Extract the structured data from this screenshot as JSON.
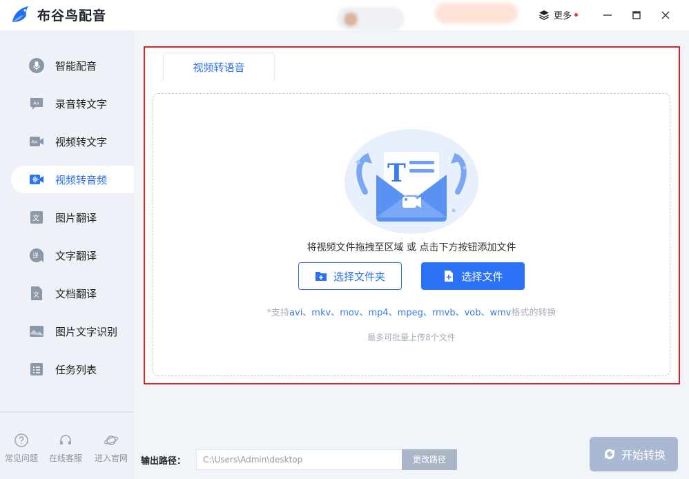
{
  "app": {
    "name": "布谷鸟配音",
    "more_label": "更多"
  },
  "sidebar": {
    "items": [
      {
        "label": "智能配音",
        "icon": "mic-icon"
      },
      {
        "label": "录音转文字",
        "icon": "audio-to-text-icon"
      },
      {
        "label": "视频转文字",
        "icon": "video-to-text-icon"
      },
      {
        "label": "视频转音频",
        "icon": "video-to-audio-icon",
        "active": true
      },
      {
        "label": "图片翻译",
        "icon": "image-translate-icon"
      },
      {
        "label": "文字翻译",
        "icon": "text-translate-icon"
      },
      {
        "label": "文档翻译",
        "icon": "document-translate-icon"
      },
      {
        "label": "图片文字识别",
        "icon": "image-ocr-icon"
      },
      {
        "label": "任务列表",
        "icon": "task-list-icon"
      }
    ],
    "footer": [
      {
        "label": "常见问题",
        "icon": "question-icon"
      },
      {
        "label": "在线客服",
        "icon": "headset-icon"
      },
      {
        "label": "进入官网",
        "icon": "planet-icon"
      }
    ]
  },
  "main": {
    "tab_label": "视频转语音",
    "drop_hint": "将视频文件拖拽至区域 或 点击下方按钮添加文件",
    "select_folder_label": "选择文件夹",
    "select_file_label": "选择文件",
    "formats_prefix": "*支持",
    "formats_list": "avi、mkv、mov、mp4、mpeg、rmvb、vob、wmv",
    "formats_suffix": "格式的转换",
    "limit_text": "最多可批量上传8个文件"
  },
  "footer": {
    "output_label": "输出路径：",
    "output_path": "C:\\Users\\Admin\\desktop",
    "change_path_label": "更改路径",
    "start_label": "开始转换"
  },
  "colors": {
    "accent": "#2b72f6",
    "highlight_border": "#e02424",
    "start_button_disabled": "#a9b8d3"
  }
}
